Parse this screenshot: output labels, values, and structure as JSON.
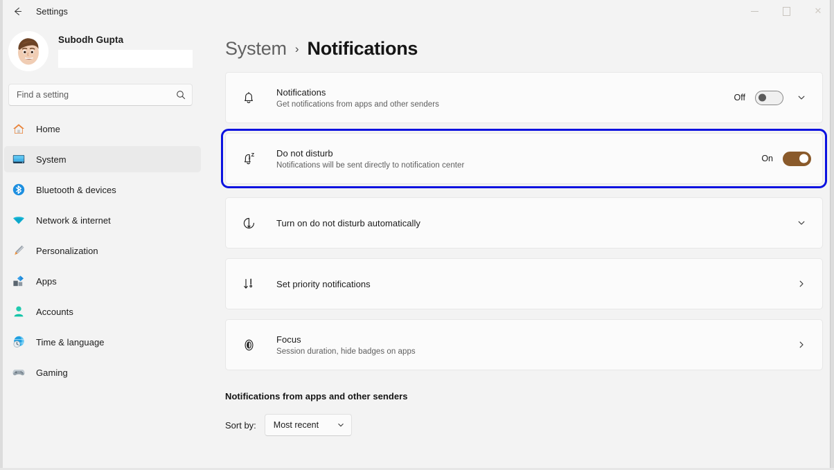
{
  "theme": {
    "accent": "#8a5a2b",
    "highlight": "#0b12e0",
    "window_bg": "#f3f3f3",
    "card_bg": "#fbfbfb"
  },
  "titlebar": {
    "back_label": "back-arrow",
    "title": "Settings",
    "minimize": "minimize",
    "maximize": "maximize",
    "close": "close"
  },
  "sidebar": {
    "profile": {
      "name": "Subodh Gupta",
      "email_redacted": ""
    },
    "search": {
      "placeholder": "Find a setting",
      "value": ""
    },
    "items": [
      {
        "label": "Home",
        "icon": "home-icon",
        "selected": false
      },
      {
        "label": "System",
        "icon": "system-icon",
        "selected": true
      },
      {
        "label": "Bluetooth & devices",
        "icon": "bluetooth-icon",
        "selected": false
      },
      {
        "label": "Network & internet",
        "icon": "network-icon",
        "selected": false
      },
      {
        "label": "Personalization",
        "icon": "personalization-icon",
        "selected": false
      },
      {
        "label": "Apps",
        "icon": "apps-icon",
        "selected": false
      },
      {
        "label": "Accounts",
        "icon": "accounts-icon",
        "selected": false
      },
      {
        "label": "Time & language",
        "icon": "time-language-icon",
        "selected": false
      },
      {
        "label": "Gaming",
        "icon": "gaming-icon",
        "selected": false
      }
    ]
  },
  "main": {
    "breadcrumb": {
      "parent": "System",
      "separator": "›",
      "current": "Notifications"
    },
    "cards": [
      {
        "id": "notifications",
        "icon": "bell-icon",
        "title": "Notifications",
        "subtitle": "Get notifications from apps and other senders",
        "toggle_label": "Off",
        "toggle_state": "off",
        "expander": "chevron-down-icon",
        "highlighted": false
      },
      {
        "id": "do-not-disturb",
        "icon": "bell-sleep-icon",
        "title": "Do not disturb",
        "subtitle": "Notifications will be sent directly to notification center",
        "toggle_label": "On",
        "toggle_state": "on",
        "expander": "",
        "highlighted": true
      },
      {
        "id": "turn-on-dnd-automatically",
        "icon": "clock-auto-icon",
        "title": "Turn on do not disturb automatically",
        "subtitle": "",
        "toggle_label": "",
        "toggle_state": "none",
        "expander": "chevron-down-icon",
        "highlighted": false
      },
      {
        "id": "set-priority-notifications",
        "icon": "priority-icon",
        "title": "Set priority notifications",
        "subtitle": "",
        "toggle_label": "",
        "toggle_state": "none",
        "expander": "chevron-right-icon",
        "highlighted": false
      },
      {
        "id": "focus",
        "icon": "focus-icon",
        "title": "Focus",
        "subtitle": "Session duration, hide badges on apps",
        "toggle_label": "",
        "toggle_state": "none",
        "expander": "chevron-right-icon",
        "highlighted": false
      }
    ],
    "section": {
      "heading": "Notifications from apps and other senders",
      "sort_label": "Sort by:",
      "sort_value": "Most recent",
      "sort_chevron": "chevron-down-icon"
    }
  }
}
